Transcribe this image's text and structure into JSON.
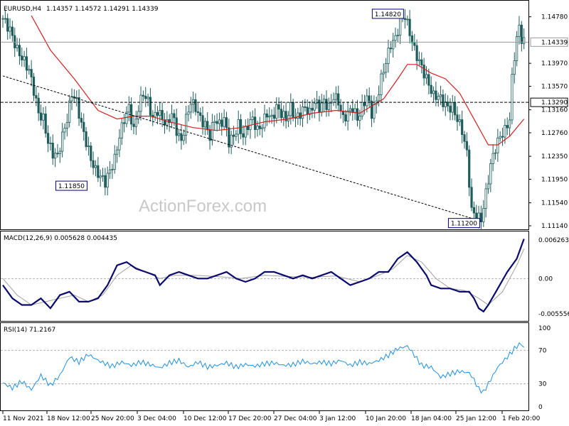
{
  "header": {
    "symbol": "EURUSD,H4",
    "ohlc": "1.14357 1.14572 1.14291 1.14339"
  },
  "watermark": "ActionForex.com",
  "colors": {
    "candle": "#1f5c5c",
    "ma": "#d42020",
    "macd": "#0a0a6e",
    "signal": "#a0a0a0",
    "rsi": "#1f8fe0",
    "label_border": "#000080",
    "label_text": "#000080"
  },
  "chart_data": [
    {
      "type": "candlestick",
      "panel": "price",
      "title": "EURUSD,H4",
      "ylim": [
        1.1114,
        1.1485
      ],
      "yticks": [
        "1.14780",
        "1.13970",
        "1.13570",
        "1.13160",
        "1.12760",
        "1.12350",
        "1.11950",
        "1.11540",
        "1.11140"
      ],
      "current_price": "1.14339",
      "horizontal_line": "1.13290",
      "annotations": [
        "1.14820",
        "1.11850",
        "1.11200"
      ],
      "close_path": [
        [
          0,
          1.1475
        ],
        [
          3,
          1.1455
        ],
        [
          6,
          1.142
        ],
        [
          9,
          1.14
        ],
        [
          11,
          1.1385
        ],
        [
          13,
          1.135
        ],
        [
          15,
          1.131
        ],
        [
          17,
          1.13
        ],
        [
          19,
          1.126
        ],
        [
          21,
          1.124
        ],
        [
          23,
          1.1235
        ],
        [
          25,
          1.127
        ],
        [
          27,
          1.13
        ],
        [
          29,
          1.1345
        ],
        [
          31,
          1.133
        ],
        [
          33,
          1.129
        ],
        [
          35,
          1.126
        ],
        [
          37,
          1.123
        ],
        [
          39,
          1.121
        ],
        [
          41,
          1.12
        ],
        [
          43,
          1.119
        ],
        [
          45,
          1.121
        ],
        [
          47,
          1.123
        ],
        [
          49,
          1.127
        ],
        [
          51,
          1.13
        ],
        [
          53,
          1.132
        ],
        [
          55,
          1.128
        ],
        [
          57,
          1.132
        ],
        [
          59,
          1.1345
        ],
        [
          61,
          1.133
        ],
        [
          63,
          1.13
        ],
        [
          65,
          1.1315
        ],
        [
          67,
          1.13
        ],
        [
          69,
          1.129
        ],
        [
          71,
          1.131
        ],
        [
          73,
          1.128
        ],
        [
          75,
          1.126
        ],
        [
          77,
          1.13
        ],
        [
          79,
          1.133
        ],
        [
          81,
          1.132
        ],
        [
          83,
          1.13
        ],
        [
          85,
          1.129
        ],
        [
          87,
          1.127
        ],
        [
          89,
          1.13
        ],
        [
          91,
          1.129
        ],
        [
          93,
          1.13
        ],
        [
          95,
          1.126
        ],
        [
          97,
          1.127
        ],
        [
          99,
          1.129
        ],
        [
          101,
          1.127
        ],
        [
          103,
          1.129
        ],
        [
          105,
          1.13
        ],
        [
          107,
          1.128
        ],
        [
          109,
          1.129
        ],
        [
          111,
          1.131
        ],
        [
          113,
          1.13
        ],
        [
          115,
          1.132
        ],
        [
          117,
          1.131
        ],
        [
          119,
          1.13
        ],
        [
          121,
          1.132
        ],
        [
          123,
          1.13
        ],
        [
          125,
          1.131
        ],
        [
          127,
          1.132
        ],
        [
          129,
          1.131
        ],
        [
          131,
          1.133
        ],
        [
          133,
          1.132
        ],
        [
          135,
          1.133
        ],
        [
          137,
          1.132
        ],
        [
          139,
          1.134
        ],
        [
          141,
          1.133
        ],
        [
          143,
          1.13
        ],
        [
          145,
          1.131
        ],
        [
          147,
          1.132
        ],
        [
          149,
          1.13
        ],
        [
          151,
          1.132
        ],
        [
          153,
          1.134
        ],
        [
          155,
          1.131
        ],
        [
          157,
          1.133
        ],
        [
          159,
          1.137
        ],
        [
          161,
          1.14
        ],
        [
          163,
          1.143
        ],
        [
          165,
          1.144
        ],
        [
          167,
          1.147
        ],
        [
          169,
          1.148
        ],
        [
          171,
          1.145
        ],
        [
          173,
          1.142
        ],
        [
          175,
          1.14
        ],
        [
          177,
          1.138
        ],
        [
          179,
          1.136
        ],
        [
          181,
          1.134
        ],
        [
          183,
          1.134
        ],
        [
          185,
          1.133
        ],
        [
          187,
          1.132
        ],
        [
          189,
          1.132
        ],
        [
          191,
          1.13
        ],
        [
          193,
          1.128
        ],
        [
          195,
          1.124
        ],
        [
          196,
          1.119
        ],
        [
          197,
          1.114
        ],
        [
          199,
          1.113
        ],
        [
          201,
          1.1125
        ],
        [
          203,
          1.117
        ],
        [
          205,
          1.122
        ],
        [
          207,
          1.125
        ],
        [
          209,
          1.127
        ],
        [
          211,
          1.128
        ],
        [
          213,
          1.13
        ],
        [
          214,
          1.137
        ],
        [
          215,
          1.141
        ],
        [
          216,
          1.144
        ],
        [
          217,
          1.146
        ],
        [
          218,
          1.144
        ],
        [
          219,
          1.1434
        ]
      ],
      "ma_path": [
        [
          12,
          1.148
        ],
        [
          20,
          1.142
        ],
        [
          30,
          1.137
        ],
        [
          40,
          1.1315
        ],
        [
          48,
          1.13
        ],
        [
          55,
          1.1305
        ],
        [
          62,
          1.1305
        ],
        [
          70,
          1.1295
        ],
        [
          80,
          1.1285
        ],
        [
          90,
          1.128
        ],
        [
          100,
          1.1285
        ],
        [
          110,
          1.1295
        ],
        [
          120,
          1.13
        ],
        [
          130,
          1.131
        ],
        [
          140,
          1.1315
        ],
        [
          150,
          1.131
        ],
        [
          160,
          1.1335
        ],
        [
          166,
          1.137
        ],
        [
          170,
          1.1395
        ],
        [
          174,
          1.1395
        ],
        [
          180,
          1.138
        ],
        [
          186,
          1.137
        ],
        [
          192,
          1.1345
        ],
        [
          198,
          1.13
        ],
        [
          204,
          1.1255
        ],
        [
          208,
          1.1255
        ],
        [
          213,
          1.127
        ],
        [
          219,
          1.13
        ]
      ],
      "trendline": [
        [
          0,
          1.1375
        ],
        [
          201,
          1.1122
        ]
      ]
    },
    {
      "type": "line",
      "panel": "macd",
      "title": "MACD(12,26,9) 0.005628 0.004435",
      "ylim": [
        -0.0062,
        0.0067
      ],
      "yticks": [
        "0.006263",
        "0.00",
        "-0.005556"
      ],
      "series": [
        {
          "role": "macd",
          "values": [
            [
              0,
              -0.001
            ],
            [
              4,
              -0.003
            ],
            [
              8,
              -0.004
            ],
            [
              12,
              -0.004
            ],
            [
              16,
              -0.003
            ],
            [
              20,
              -0.0045
            ],
            [
              24,
              -0.0025
            ],
            [
              28,
              -0.002
            ],
            [
              32,
              -0.0035
            ],
            [
              36,
              -0.0035
            ],
            [
              40,
              -0.003
            ],
            [
              44,
              -0.001
            ],
            [
              48,
              0.002
            ],
            [
              52,
              0.0025
            ],
            [
              56,
              0.0015
            ],
            [
              60,
              0.001
            ],
            [
              64,
              0.0005
            ],
            [
              66,
              -0.001
            ],
            [
              70,
              0.0005
            ],
            [
              74,
              0.001
            ],
            [
              78,
              0.0005
            ],
            [
              82,
              0.0
            ],
            [
              86,
              0.0
            ],
            [
              90,
              0.0005
            ],
            [
              94,
              0.001
            ],
            [
              98,
              0.0
            ],
            [
              102,
              -0.0005
            ],
            [
              106,
              0.0
            ],
            [
              110,
              0.001
            ],
            [
              114,
              0.001
            ],
            [
              118,
              0.0005
            ],
            [
              122,
              0.0
            ],
            [
              126,
              0.0005
            ],
            [
              130,
              0.0
            ],
            [
              134,
              0.0005
            ],
            [
              138,
              0.001
            ],
            [
              142,
              0.0
            ],
            [
              146,
              -0.001
            ],
            [
              150,
              -0.0005
            ],
            [
              154,
              0.0
            ],
            [
              158,
              0.001
            ],
            [
              162,
              0.001
            ],
            [
              166,
              0.003
            ],
            [
              170,
              0.004
            ],
            [
              174,
              0.0025
            ],
            [
              178,
              0.0005
            ],
            [
              180,
              -0.001
            ],
            [
              184,
              -0.0015
            ],
            [
              188,
              -0.0015
            ],
            [
              192,
              -0.002
            ],
            [
              196,
              -0.002
            ],
            [
              198,
              -0.003
            ],
            [
              200,
              -0.0045
            ],
            [
              202,
              -0.005
            ],
            [
              204,
              -0.004
            ],
            [
              208,
              -0.0015
            ],
            [
              212,
              0.001
            ],
            [
              216,
              0.003
            ],
            [
              219,
              0.006
            ]
          ]
        },
        {
          "role": "signal",
          "values": [
            [
              0,
              0.0
            ],
            [
              6,
              -0.0025
            ],
            [
              12,
              -0.004
            ],
            [
              18,
              -0.0035
            ],
            [
              24,
              -0.003
            ],
            [
              30,
              -0.0025
            ],
            [
              36,
              -0.0035
            ],
            [
              42,
              -0.0025
            ],
            [
              48,
              0.0005
            ],
            [
              54,
              0.002
            ],
            [
              60,
              0.001
            ],
            [
              66,
              0.0
            ],
            [
              72,
              0.0005
            ],
            [
              80,
              0.0005
            ],
            [
              90,
              0.0003
            ],
            [
              100,
              0.0
            ],
            [
              110,
              0.0005
            ],
            [
              120,
              0.0003
            ],
            [
              130,
              0.0002
            ],
            [
              140,
              0.0004
            ],
            [
              150,
              -0.0005
            ],
            [
              158,
              0.0005
            ],
            [
              164,
              0.0015
            ],
            [
              170,
              0.0035
            ],
            [
              176,
              0.0025
            ],
            [
              182,
              0.0
            ],
            [
              188,
              -0.0015
            ],
            [
              194,
              -0.0018
            ],
            [
              200,
              -0.003
            ],
            [
              204,
              -0.004
            ],
            [
              210,
              -0.002
            ],
            [
              216,
              0.002
            ],
            [
              219,
              0.0045
            ]
          ]
        }
      ]
    },
    {
      "type": "line",
      "panel": "rsi",
      "title": "RSI(14) 71.2167",
      "ylim": [
        0,
        100
      ],
      "yticks": [
        "100",
        "70",
        "30",
        "0"
      ],
      "levels": [
        70,
        30
      ],
      "series": [
        {
          "role": "rsi",
          "values": [
            [
              0,
              31
            ],
            [
              4,
              25
            ],
            [
              8,
              33
            ],
            [
              12,
              23
            ],
            [
              16,
              40
            ],
            [
              20,
              28
            ],
            [
              24,
              40
            ],
            [
              28,
              62
            ],
            [
              32,
              56
            ],
            [
              36,
              65
            ],
            [
              40,
              58
            ],
            [
              44,
              53
            ],
            [
              46,
              51
            ],
            [
              50,
              56
            ],
            [
              54,
              52
            ],
            [
              58,
              56
            ],
            [
              62,
              53
            ],
            [
              66,
              49
            ],
            [
              70,
              55
            ],
            [
              74,
              58
            ],
            [
              78,
              50
            ],
            [
              82,
              56
            ],
            [
              86,
              50
            ],
            [
              90,
              52
            ],
            [
              94,
              55
            ],
            [
              98,
              50
            ],
            [
              102,
              53
            ],
            [
              106,
              51
            ],
            [
              110,
              54
            ],
            [
              114,
              55
            ],
            [
              118,
              52
            ],
            [
              122,
              53
            ],
            [
              126,
              57
            ],
            [
              130,
              54
            ],
            [
              134,
              56
            ],
            [
              138,
              54
            ],
            [
              142,
              58
            ],
            [
              146,
              52
            ],
            [
              150,
              56
            ],
            [
              154,
              54
            ],
            [
              158,
              58
            ],
            [
              162,
              64
            ],
            [
              166,
              72
            ],
            [
              170,
              75
            ],
            [
              172,
              68
            ],
            [
              176,
              52
            ],
            [
              180,
              50
            ],
            [
              184,
              38
            ],
            [
              188,
              42
            ],
            [
              192,
              45
            ],
            [
              196,
              43
            ],
            [
              198,
              35
            ],
            [
              200,
              24
            ],
            [
              202,
              20
            ],
            [
              204,
              30
            ],
            [
              208,
              50
            ],
            [
              212,
              62
            ],
            [
              216,
              75
            ],
            [
              218,
              78
            ],
            [
              219,
              72
            ]
          ]
        }
      ]
    }
  ],
  "x_axis": {
    "labels": [
      "11 Nov 2021",
      "18 Nov 12:00",
      "25 Nov 20:00",
      "3 Dec 04:00",
      "10 Dec 12:00",
      "17 Dec 20:00",
      "27 Dec 04:00",
      "3 Jan 12:00",
      "10 Jan 20:00",
      "18 Jan 04:00",
      "25 Jan 12:00",
      "1 Feb 20:00"
    ]
  }
}
